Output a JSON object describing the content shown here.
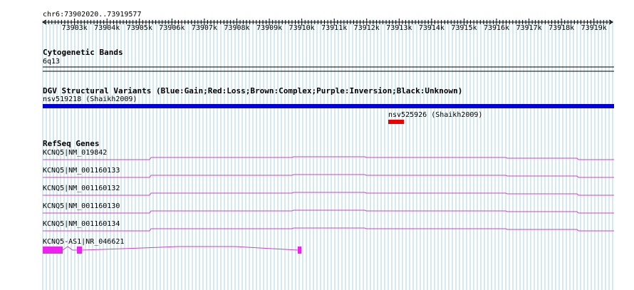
{
  "ruler": {
    "range_label": "chr6:73902020..73919577",
    "start": 73902020,
    "end": 73919577,
    "tick_labels": [
      "73903k",
      "73904k",
      "73905k",
      "73906k",
      "73907k",
      "73908k",
      "73909k",
      "73910k",
      "73911k",
      "73912k",
      "73913k",
      "73914k",
      "73915k",
      "73916k",
      "73917k",
      "73918k",
      "73919k"
    ]
  },
  "tracks": {
    "cytoband": {
      "title": "Cytogenetic Bands",
      "band": "6q13"
    },
    "dgv": {
      "title": "DGV Structural Variants (Blue:Gain;Red:Loss;Brown:Complex;Purple:Inversion;Black:Unknown)",
      "variants": [
        {
          "label": "nsv519218 (Shaikh2009)",
          "color": "#0000dd"
        },
        {
          "label": "nsv525926 (Shaikh2009)",
          "color": "#ee0000"
        }
      ]
    },
    "refseq": {
      "title": "RefSeq Genes",
      "color": "#cc44cc",
      "exon_color": "#ee22ee",
      "genes": [
        {
          "label": "KCNQ5|NM_019842"
        },
        {
          "label": "KCNQ5|NM_001160133"
        },
        {
          "label": "KCNQ5|NM_001160132"
        },
        {
          "label": "KCNQ5|NM_001160130"
        },
        {
          "label": "KCNQ5|NM_001160134"
        },
        {
          "label": "KCNQ5-AS1|NR_046621"
        }
      ]
    }
  },
  "colors": {
    "gridline": "#a8d4dc",
    "background": "#ffffff"
  }
}
